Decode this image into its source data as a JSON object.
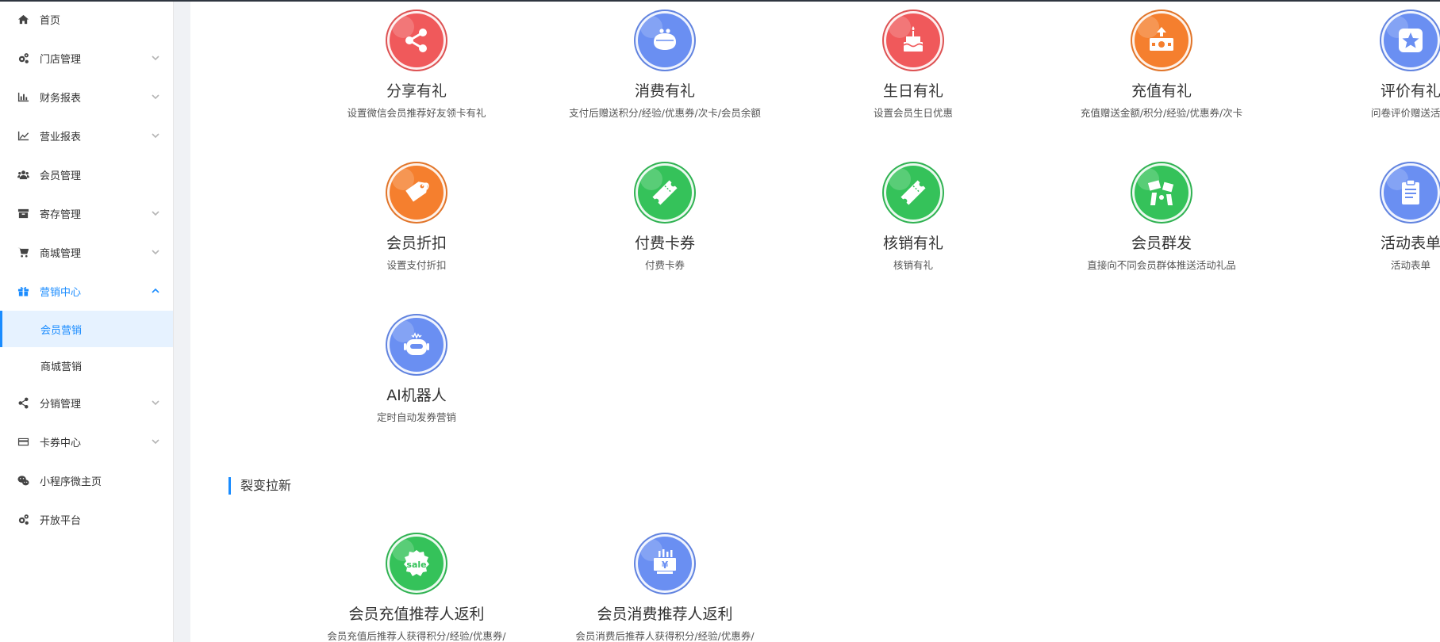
{
  "sidebar": {
    "items": [
      {
        "label": "首页",
        "icon": "home-icon",
        "has_arrow": false
      },
      {
        "label": "门店管理",
        "icon": "gears-icon",
        "has_arrow": true
      },
      {
        "label": "财务报表",
        "icon": "bar-chart-icon",
        "has_arrow": true
      },
      {
        "label": "营业报表",
        "icon": "line-chart-icon",
        "has_arrow": true
      },
      {
        "label": "会员管理",
        "icon": "users-icon",
        "has_arrow": false
      },
      {
        "label": "寄存管理",
        "icon": "archive-icon",
        "has_arrow": true
      },
      {
        "label": "商城管理",
        "icon": "cart-icon",
        "has_arrow": true
      },
      {
        "label": "营销中心",
        "icon": "gift-icon",
        "has_arrow": true,
        "active": true
      }
    ],
    "sub_items": [
      {
        "label": "会员营销",
        "selected": true
      },
      {
        "label": "商城营销",
        "selected": false
      }
    ],
    "items_after": [
      {
        "label": "分销管理",
        "icon": "share-icon",
        "has_arrow": true
      },
      {
        "label": "卡券中心",
        "icon": "card-icon",
        "has_arrow": true
      },
      {
        "label": "小程序微主页",
        "icon": "wechat-icon",
        "has_arrow": false
      },
      {
        "label": "开放平台",
        "icon": "gears-icon",
        "has_arrow": false
      }
    ]
  },
  "cards": [
    {
      "title": "分享有礼",
      "desc": "设置微信会员推荐好友领卡有礼",
      "icon": "share-icon",
      "color": "#f0595b"
    },
    {
      "title": "消费有礼",
      "desc": "支付后赠送积分/经验/优惠券/次卡/会员余额",
      "icon": "purse-icon",
      "color": "#6a8ff2"
    },
    {
      "title": "生日有礼",
      "desc": "设置会员生日优惠",
      "icon": "cake-icon",
      "color": "#f0595b"
    },
    {
      "title": "充值有礼",
      "desc": "充值赠送金额/积分/经验/优惠券/次卡",
      "icon": "money-upload-icon",
      "color": "#f57f2e"
    },
    {
      "title": "评价有礼",
      "desc": "问卷评价赠送活动",
      "icon": "star-icon",
      "color": "#6a8ff2"
    },
    {
      "title": "会员折扣",
      "desc": "设置支付折扣",
      "icon": "tag-icon",
      "color": "#f57f2e"
    },
    {
      "title": "付费卡券",
      "desc": "付费卡券",
      "icon": "ticket-icon",
      "color": "#35c25a"
    },
    {
      "title": "核销有礼",
      "desc": "核销有礼",
      "icon": "ticket-icon",
      "color": "#35c25a"
    },
    {
      "title": "会员群发",
      "desc": "直接向不同会员群体推送活动礼品",
      "icon": "broadcast-icon",
      "color": "#35c25a"
    },
    {
      "title": "活动表单",
      "desc": "活动表单",
      "icon": "clipboard-icon",
      "color": "#6a8ff2"
    },
    {
      "title": "AI机器人",
      "desc": "定时自动发券营销",
      "icon": "robot-icon",
      "color": "#6a8ff2"
    }
  ],
  "section2": {
    "title": "裂变拉新",
    "cards": [
      {
        "title": "会员充值推荐人返利",
        "desc": "会员充值后推荐人获得积分/经验/优惠券/",
        "icon": "sale-badge-icon",
        "color": "#35c25a",
        "badge_text": "sale"
      },
      {
        "title": "会员消费推荐人返利",
        "desc": "会员消费后推荐人获得积分/经验/优惠券/",
        "icon": "yen-chart-icon",
        "color": "#6a8ff2",
        "badge_text": "¥"
      }
    ]
  }
}
